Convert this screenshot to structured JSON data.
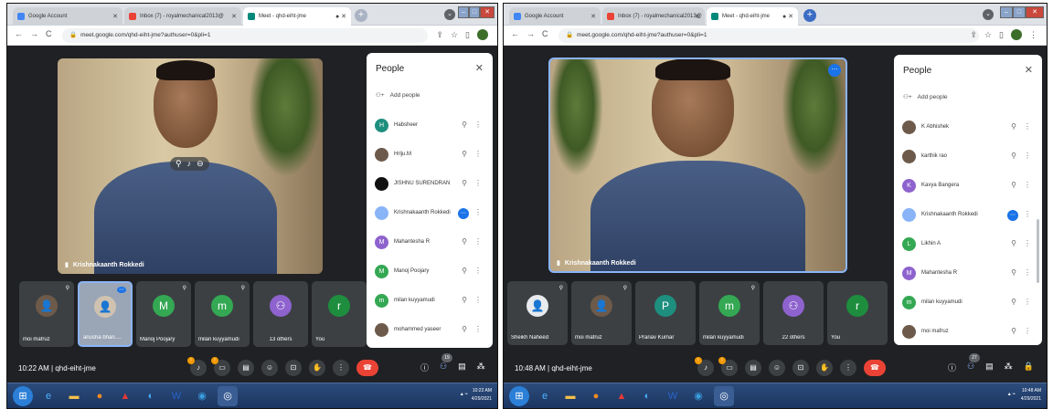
{
  "left": {
    "tabs": [
      "Google Account",
      "Inbox (7) - royalmechanical2013@",
      "Meet - qhd-eiht-jme"
    ],
    "url": "meet.google.com/qhd-eiht-jme?authuser=0&pli=1",
    "main_speaker": "Krishnakaanth Rokkedi",
    "tiles": [
      {
        "name": "moi mafruz"
      },
      {
        "name": "anusha bhari...."
      },
      {
        "name": "Manoj Poojary",
        "initial": "M"
      },
      {
        "name": "milan kuyyamudi",
        "initial": "m"
      },
      {
        "name": "13 others"
      },
      {
        "name": "You",
        "initial": "r"
      }
    ],
    "people": {
      "title": "People",
      "add": "Add people",
      "list": [
        {
          "name": "Habsheer",
          "initial": "H"
        },
        {
          "name": "Hrlju.M",
          "initial": ""
        },
        {
          "name": "JISHNU SURENDRAN",
          "initial": ""
        },
        {
          "name": "Krishnakaanth Rokkedi",
          "initial": ""
        },
        {
          "name": "Mahantesha R",
          "initial": "M"
        },
        {
          "name": "Manoj Poojary",
          "initial": "M"
        },
        {
          "name": "milan kuyyamudi",
          "initial": "m"
        },
        {
          "name": "mohammed yaseer",
          "initial": ""
        }
      ]
    },
    "time": "10:22 AM",
    "meeting_code": "qhd-eiht-jme",
    "people_count": "19",
    "clock_time": "10:22 AM",
    "clock_date": "4/29/2021"
  },
  "right": {
    "tabs": [
      "Google Account",
      "Inbox (7) - royalmechanical2013@",
      "Meet - qhd-eiht-jme"
    ],
    "url": "meet.google.com/qhd-eiht-jme?authuser=0&pli=1",
    "main_speaker": "Krishnakaanth Rokkedi",
    "tiles": [
      {
        "name": "Sheikh Naheed"
      },
      {
        "name": "moi mafruz"
      },
      {
        "name": "Pranav Kumar",
        "initial": "P"
      },
      {
        "name": "milan kuyyamudi",
        "initial": "m"
      },
      {
        "name": "22 others"
      },
      {
        "name": "You",
        "initial": "r"
      }
    ],
    "people": {
      "title": "People",
      "add": "Add people",
      "list": [
        {
          "name": "K Abhishek",
          "initial": ""
        },
        {
          "name": "karthik rao",
          "initial": ""
        },
        {
          "name": "Kavya Bangera",
          "initial": "K"
        },
        {
          "name": "Krishnakaanth Rokkedi",
          "initial": ""
        },
        {
          "name": "Likhin A",
          "initial": "L"
        },
        {
          "name": "Mahantesha R",
          "initial": "M"
        },
        {
          "name": "milan kuyyamudi",
          "initial": "m"
        },
        {
          "name": "moi mafruz",
          "initial": ""
        }
      ]
    },
    "time": "10:48 AM",
    "meeting_code": "qhd-eiht-jme",
    "people_count": "27",
    "clock_time": "10:48 AM",
    "clock_date": "4/29/2021"
  },
  "colors": {
    "meet_bg": "#202124",
    "tile_bg": "#3c4043",
    "end_call": "#ea4335",
    "active_blue": "#8ab4f8",
    "avatar_green": "#34a853",
    "avatar_purple": "#8e63ce",
    "avatar_teal": "#1e8e7e",
    "warning": "#f29900"
  }
}
